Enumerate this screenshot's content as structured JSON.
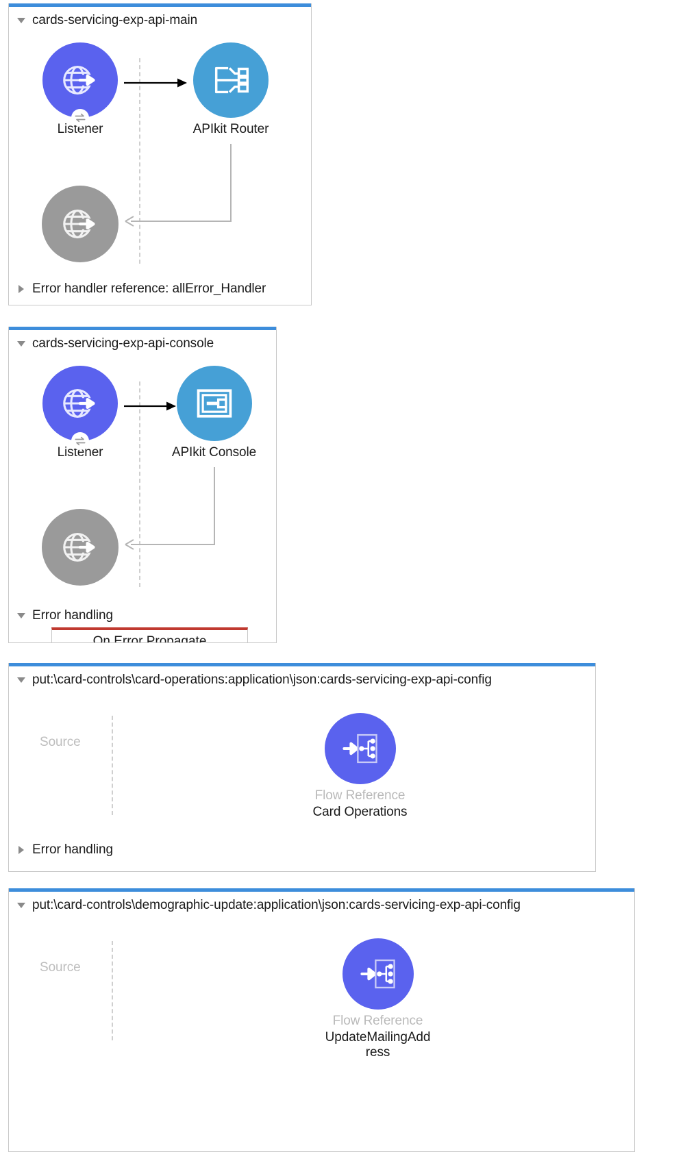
{
  "theme": {
    "accent_blue": "#3d8ddb",
    "listener_purple": "#5a62ee",
    "apikit_blue": "#46a0d6",
    "flowref_purple": "#5a62ee",
    "disabled_gray": "#9a9a9a",
    "error_red": "#c0392f",
    "panel_border": "#c8c8c8",
    "muted_text": "#bdbdbd"
  },
  "flows": [
    {
      "title": "cards-servicing-exp-api-main",
      "expanded": true,
      "nodes": [
        {
          "label": "Listener",
          "sublabel": "",
          "icon": "globe-arrow-icon",
          "style": "listener"
        },
        {
          "label": "APIkit Router",
          "sublabel": "",
          "icon": "apikit-router-icon",
          "style": "apikit"
        },
        {
          "label": "",
          "sublabel": "",
          "icon": "globe-arrow-icon",
          "style": "disabled"
        }
      ],
      "footer": {
        "label": "Error handler reference: allError_Handler",
        "expanded": false
      }
    },
    {
      "title": "cards-servicing-exp-api-console",
      "expanded": true,
      "nodes": [
        {
          "label": "Listener",
          "sublabel": "",
          "icon": "globe-arrow-icon",
          "style": "listener"
        },
        {
          "label": "APIkit Console",
          "sublabel": "",
          "icon": "apikit-console-icon",
          "style": "apikit"
        },
        {
          "label": "",
          "sublabel": "",
          "icon": "globe-arrow-icon",
          "style": "disabled"
        }
      ],
      "footer": {
        "label": "Error handling",
        "expanded": true
      },
      "error_scope": {
        "label": "On Error Propagate"
      }
    },
    {
      "title": "put:\\card-controls\\card-operations:application\\json:cards-servicing-exp-api-config",
      "expanded": true,
      "source_label": "Source",
      "nodes": [
        {
          "label": "Card Operations",
          "sublabel": "Flow Reference",
          "icon": "flow-reference-icon",
          "style": "flowref"
        }
      ],
      "footer": {
        "label": "Error handling",
        "expanded": false
      }
    },
    {
      "title": "put:\\card-controls\\demographic-update:application\\json:cards-servicing-exp-api-config",
      "expanded": true,
      "source_label": "Source",
      "nodes": [
        {
          "label": "UpdateMailingAdd​ress",
          "label_line1": "UpdateMailingAdd",
          "label_line2": "ress",
          "sublabel": "Flow Reference",
          "icon": "flow-reference-icon",
          "style": "flowref"
        }
      ]
    }
  ]
}
